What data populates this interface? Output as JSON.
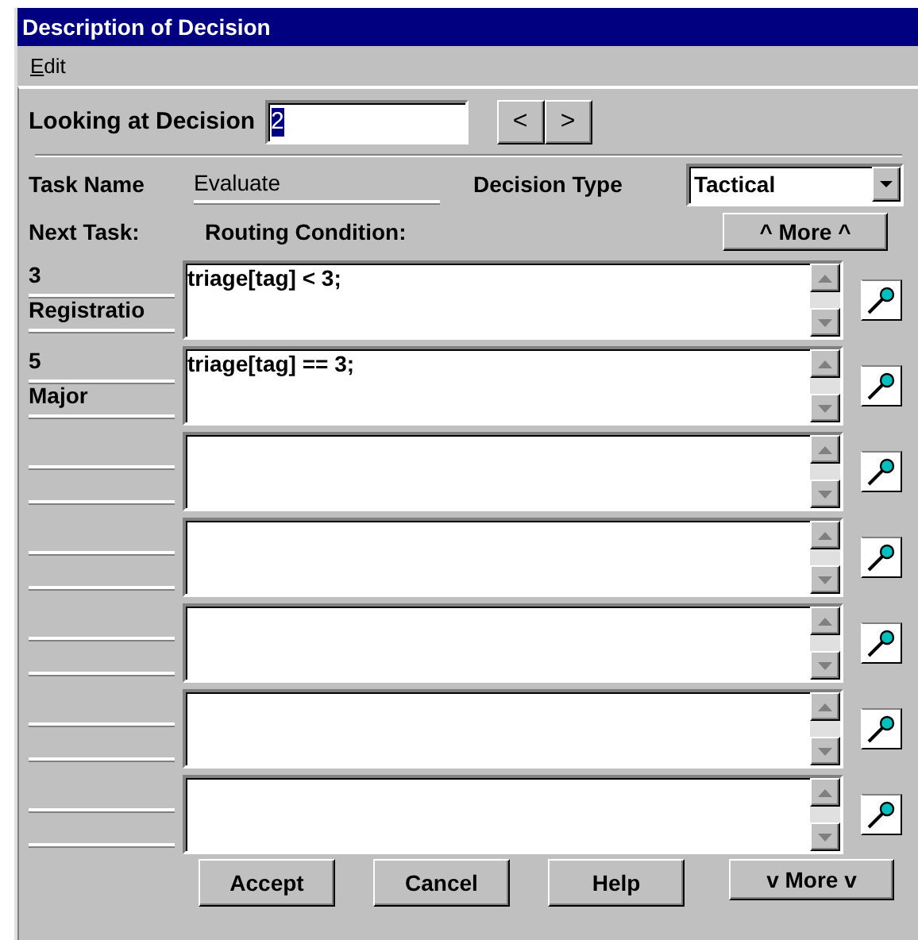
{
  "window": {
    "title": "Description of Decision"
  },
  "menu": [
    {
      "label": "Edit"
    }
  ],
  "decision": {
    "label": "Looking at Decision",
    "value": "2",
    "prev": "<",
    "next": ">"
  },
  "task_name": {
    "label": "Task Name",
    "value": "Evaluate"
  },
  "decision_type": {
    "label": "Decision Type",
    "value": "Tactical"
  },
  "headers": {
    "next_task": "Next Task:",
    "routing": "Routing Condition:",
    "more_up": "^ More ^"
  },
  "routes": [
    {
      "kind": "filled",
      "task_number": "3",
      "task_name": "Registratio",
      "condition": "triage[tag] < 3;"
    },
    {
      "kind": "filled",
      "task_number": "5",
      "task_name": "Major",
      "condition": "triage[tag] == 3;"
    },
    {
      "kind": "blank"
    },
    {
      "kind": "blank"
    },
    {
      "kind": "blank"
    },
    {
      "kind": "blank"
    },
    {
      "kind": "blank"
    }
  ],
  "buttons": [
    {
      "label": "Accept"
    },
    {
      "label": "Cancel"
    },
    {
      "label": "Help"
    }
  ],
  "more_down": "v More v"
}
